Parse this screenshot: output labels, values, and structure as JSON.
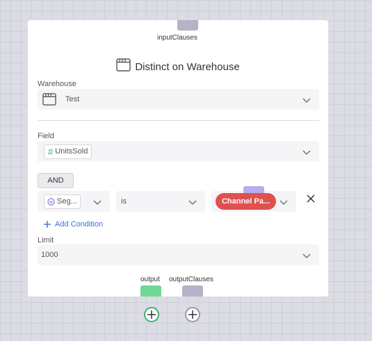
{
  "node": {
    "title": "Distinct on Warehouse",
    "input_port_label": "inputClauses",
    "output_port_label": "output",
    "output_clauses_port_label": "outputClauses"
  },
  "warehouse": {
    "label": "Warehouse",
    "value": "Test"
  },
  "field": {
    "label": "Field",
    "value": "UnitsSold"
  },
  "condition": {
    "operator_button": "AND",
    "segment_value": "Seg...",
    "comparator_value": "is",
    "value_pill": "Channel Pa..."
  },
  "add_condition_label": "Add Condition",
  "limit": {
    "label": "Limit",
    "value": "1000"
  },
  "colors": {
    "port_gray": "#b4b3c8",
    "port_green": "#6fd893",
    "port_purple": "#b6aef0",
    "pill_red": "#e0504f",
    "link_blue": "#3a6fd8",
    "number_green": "#3cb371"
  }
}
